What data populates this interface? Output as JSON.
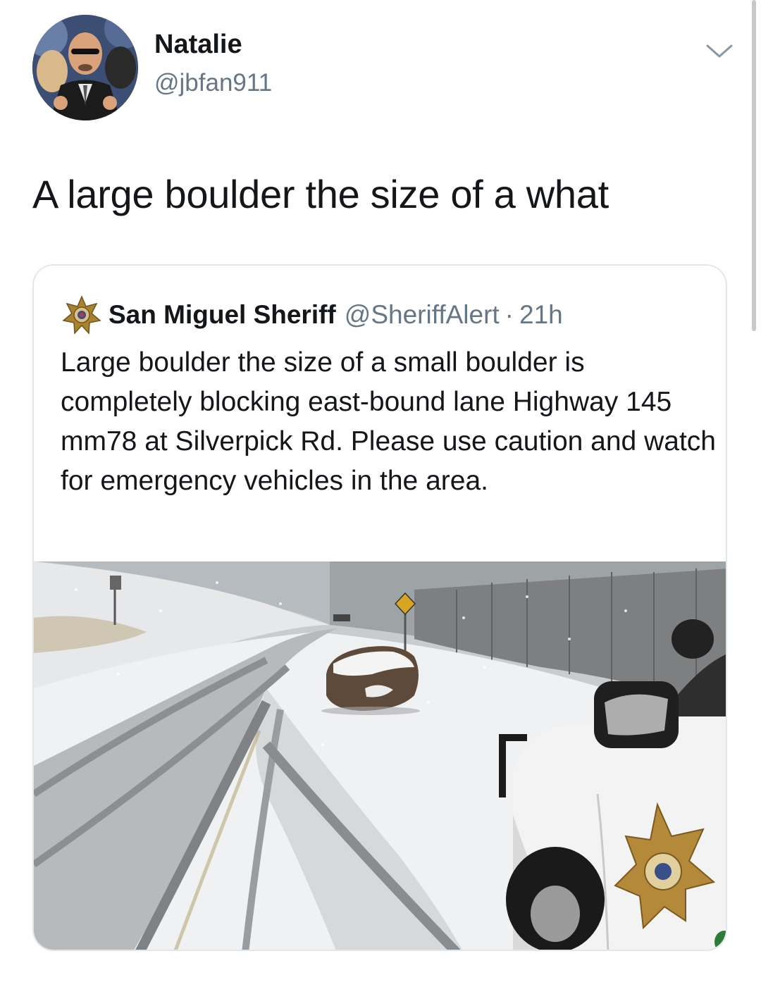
{
  "tweet": {
    "display_name": "Natalie",
    "handle": "@jbfan911",
    "text": "A large boulder the size of a what"
  },
  "quoted_tweet": {
    "display_name": "San Miguel Sheriff",
    "handle": "@SheriffAlert",
    "separator": "·",
    "time": "21h",
    "text": "Large boulder the size of a small boulder is completely blocking east-bound lane Highway 145 mm78 at Silverpick Rd. Please use caution and watch for emergency vehicles in the area."
  },
  "icons": {
    "menu": "chevron-down-icon",
    "quoted_avatar": "sheriff-star-icon"
  },
  "colors": {
    "text": "#14171a",
    "secondary_text": "#657786",
    "card_border": "#e1e8ed"
  }
}
